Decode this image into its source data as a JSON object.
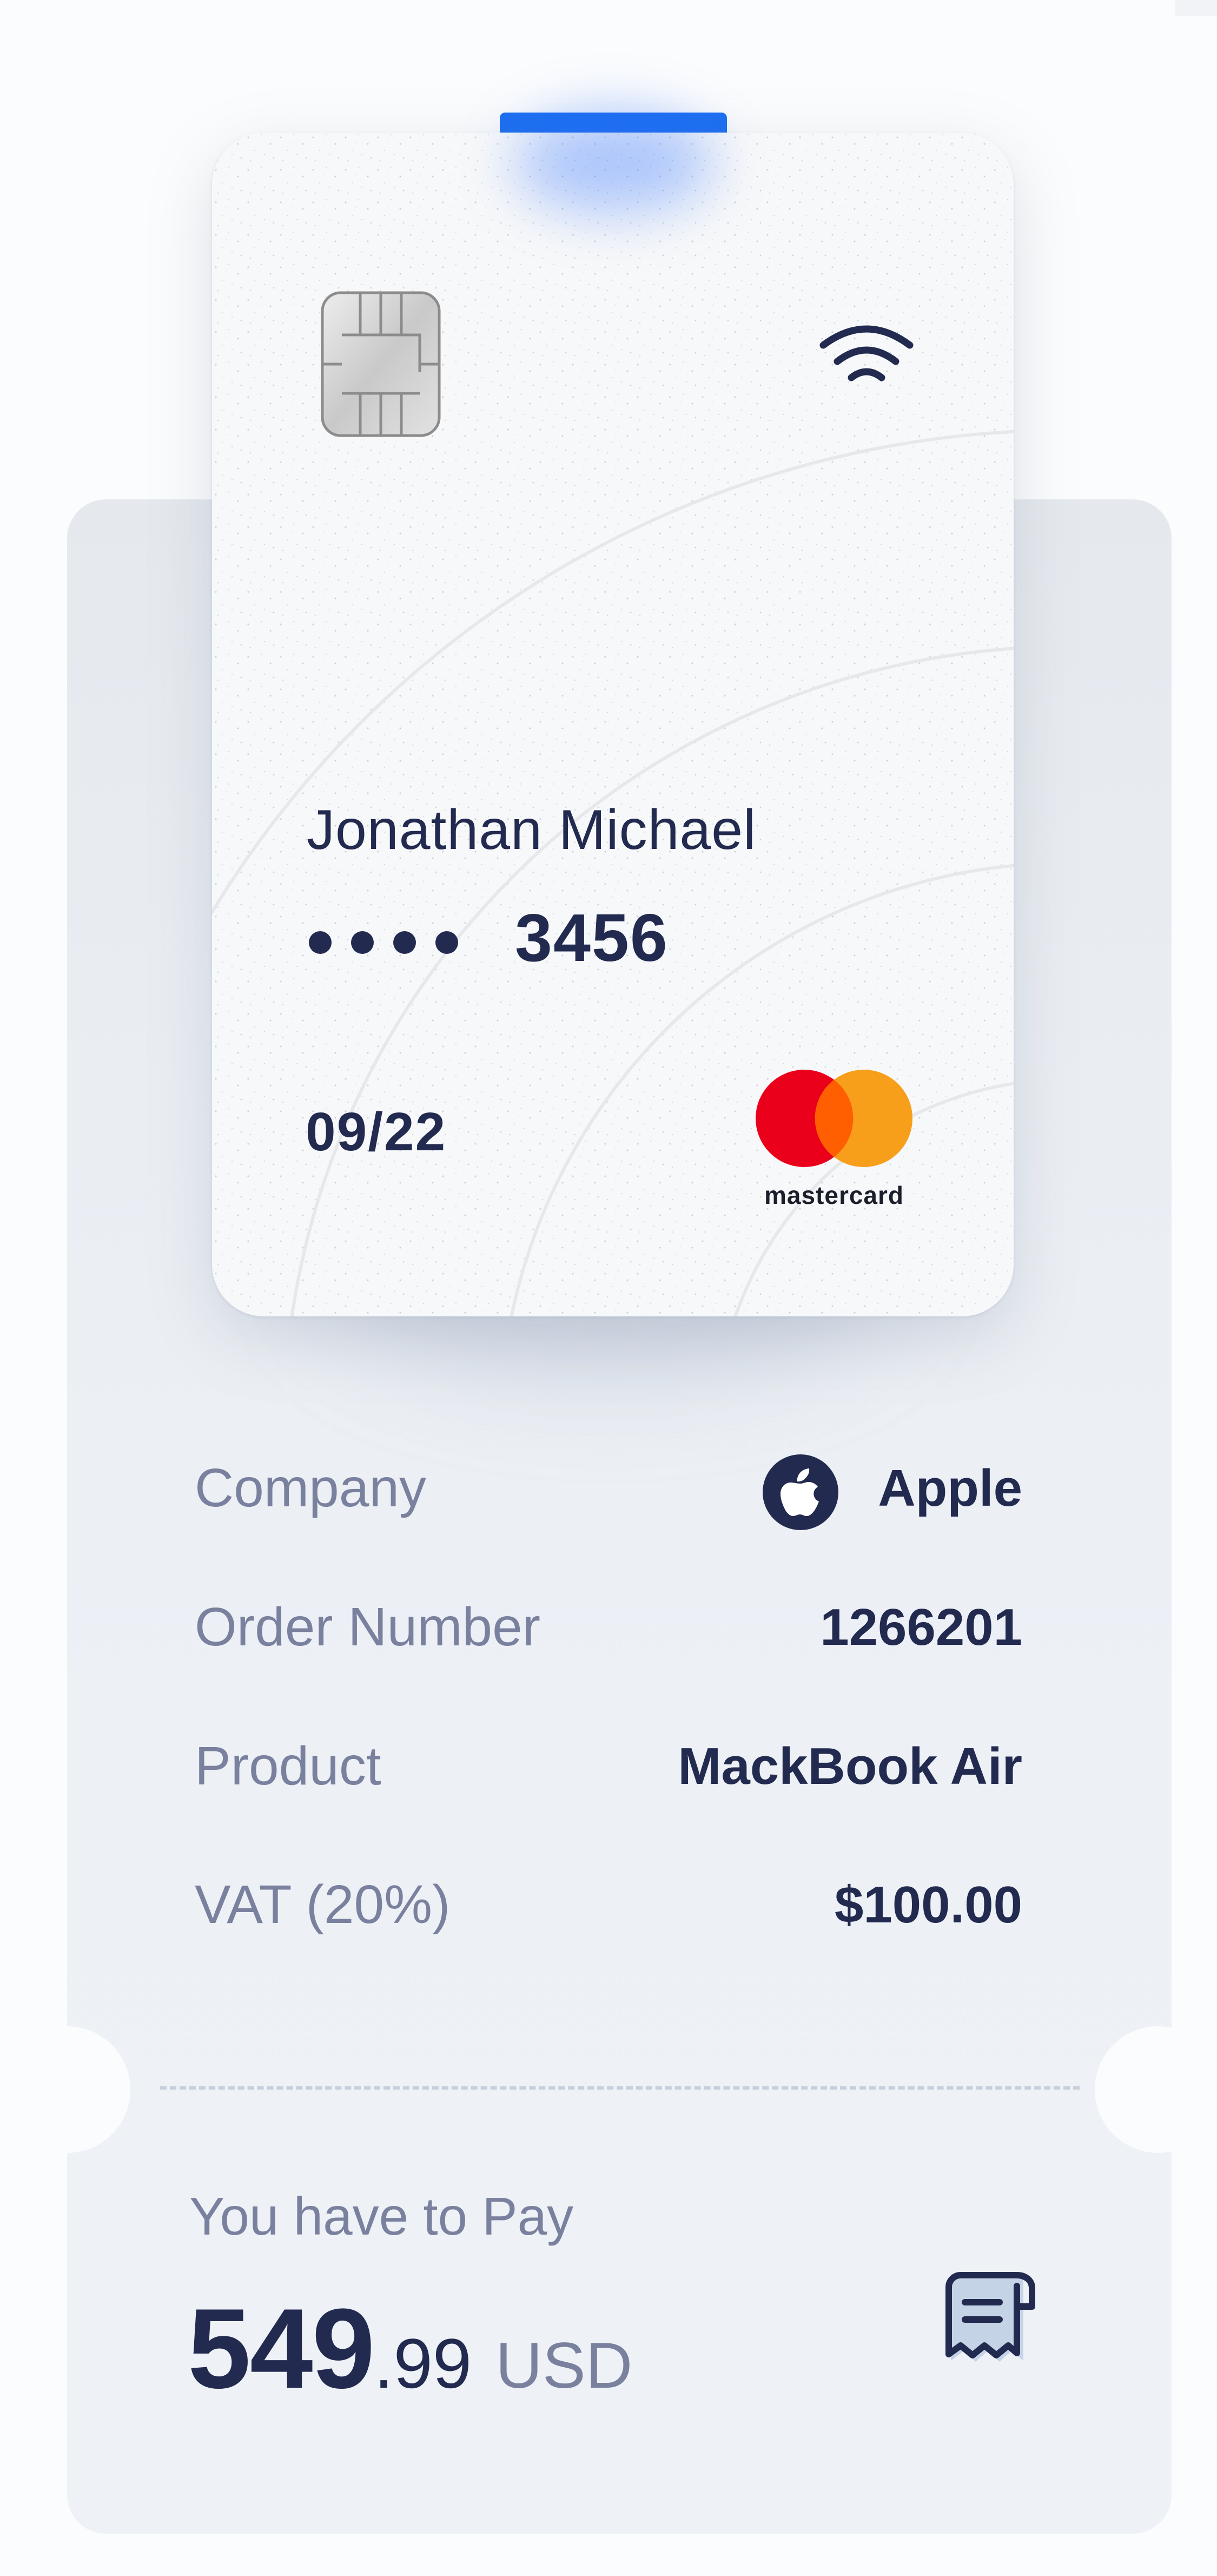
{
  "card": {
    "holder_name": "Jonathan Michael",
    "masked_digits": "••••",
    "last_four": "3456",
    "expiry": "09/22",
    "network": "mastercard",
    "accent_color": "#1b6ff2",
    "chip_icon": "chip-icon",
    "contactless_icon": "contactless-icon"
  },
  "details": [
    {
      "label": "Company",
      "value": "Apple",
      "icon": "apple-icon"
    },
    {
      "label": "Order Number",
      "value": "1266201"
    },
    {
      "label": "Product",
      "value": "MackBook Air"
    },
    {
      "label": "VAT (20%)",
      "value": "$100.00"
    }
  ],
  "payment": {
    "label": "You have to Pay",
    "amount_integer": "549",
    "amount_decimal": ".99",
    "currency": "USD",
    "icon": "receipt-icon"
  },
  "colors": {
    "text_primary": "#222a4f",
    "text_secondary": "#7a819e",
    "panel": "#edf1f6",
    "mastercard_red": "#eb001b",
    "mastercard_orange": "#f79e1b",
    "mastercard_overlap": "#ff5f00"
  }
}
